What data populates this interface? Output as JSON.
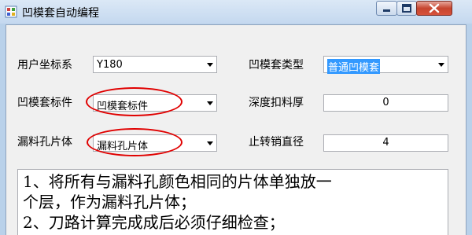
{
  "window": {
    "title": "凹模套自动编程"
  },
  "form": {
    "coord_label": "用户坐标系",
    "coord_value": "Y180",
    "die_type_label": "凹模套类型",
    "die_type_value": "普通凹模套",
    "die_mark_label": "凹模套标件",
    "die_mark_value": "凹模套标件",
    "depth_label": "深度扣料厚",
    "depth_value": "0",
    "leak_label": "漏料孔片体",
    "leak_value": "漏料孔片体",
    "pin_label": "止转销直径",
    "pin_value": "4"
  },
  "notes": {
    "line1": "1、将所有与漏料孔颜色相同的片体单独放一",
    "line2": "个层，作为漏料孔片体；",
    "line3": "2、刀路计算完成成后必须仔细检查；"
  },
  "colors": {
    "highlight_ellipse": "#e00000",
    "selection": "#3399ff"
  }
}
